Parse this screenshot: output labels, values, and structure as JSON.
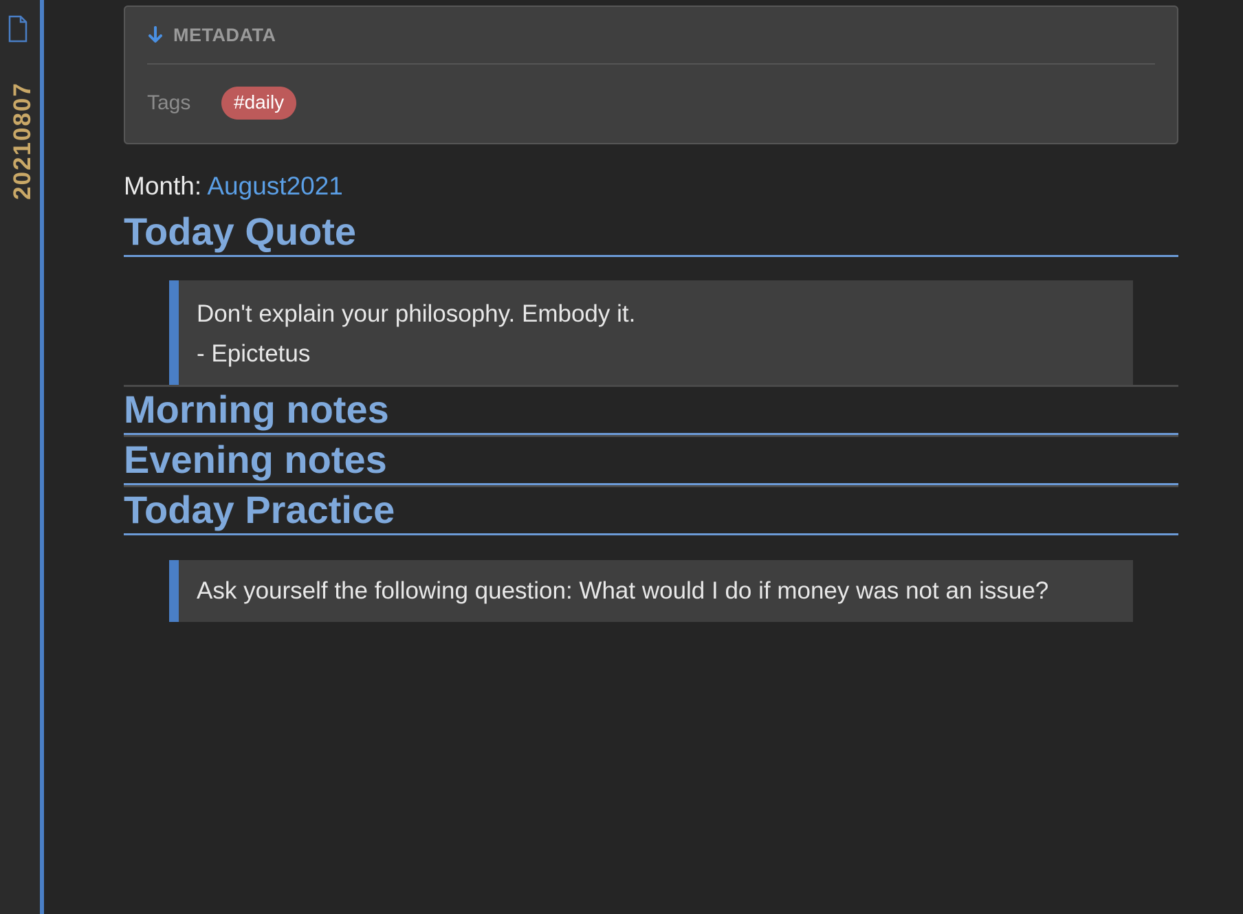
{
  "sidebar": {
    "note_title": "20210807",
    "icon": "file-icon"
  },
  "metadata": {
    "header_label": "METADATA",
    "header_icon": "arrow-down-icon",
    "tags_label": "Tags",
    "tags": [
      "#daily"
    ]
  },
  "month": {
    "label": "Month:",
    "link_text": "August2021"
  },
  "sections": {
    "quote": {
      "heading": "Today Quote",
      "lines": [
        "Don't explain your philosophy. Embody it.",
        "- Epictetus"
      ]
    },
    "morning": {
      "heading": "Morning notes"
    },
    "evening": {
      "heading": "Evening notes"
    },
    "practice": {
      "heading": "Today Practice",
      "text": "Ask yourself the following question: What would I do if money was not an issue?"
    }
  },
  "colors": {
    "background": "#252525",
    "accent": "#4a7fc6",
    "heading": "#7fa9dc",
    "link": "#5b9fe6",
    "tag": "#bd5a5a",
    "note_title": "#c9a867"
  }
}
